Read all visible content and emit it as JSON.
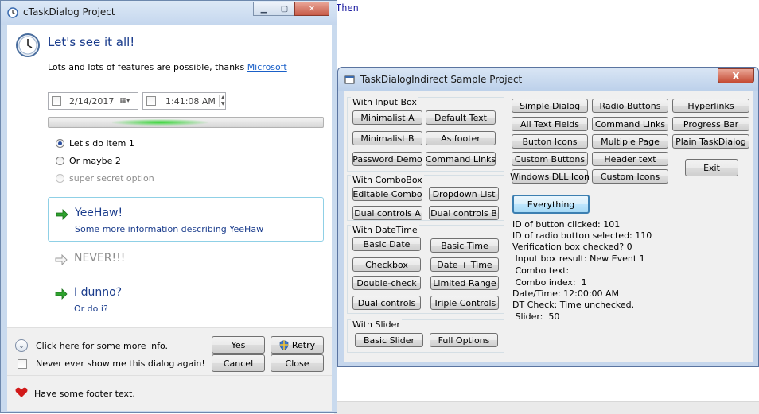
{
  "background": {
    "code_fragment": "Then"
  },
  "win1": {
    "title": "cTaskDialog Project",
    "main_instruction": "Let's see it all!",
    "content_prefix": "Lots and lots of features are possible, thanks ",
    "content_link": "Microsoft",
    "date_value": "2/14/2017",
    "time_value": "1:41:08 AM",
    "progress": 0.3,
    "radios": [
      {
        "label": "Let's do item 1",
        "selected": true
      },
      {
        "label": "Or maybe 2",
        "selected": false
      },
      {
        "label": "super secret option",
        "selected": false,
        "disabled": true
      }
    ],
    "command_links": [
      {
        "title": "YeeHaw!",
        "note": "Some more information describing YeeHaw"
      },
      {
        "title": "NEVER!!!",
        "note": ""
      },
      {
        "title": "I dunno?",
        "note": "Or do i?"
      }
    ],
    "expander_text": "Click here for some more info.",
    "verification_text": "Never ever show me this dialog again!",
    "buttons": {
      "yes": "Yes",
      "retry": "Retry",
      "cancel": "Cancel",
      "close": "Close"
    },
    "footer_text": "Have some footer text."
  },
  "win2": {
    "title": "TaskDialogIndirect Sample Project",
    "close_glyph": "X",
    "groups": {
      "input": {
        "title": "With Input Box",
        "buttons": [
          "Minimalist A",
          "Default Text",
          "Minimalist B",
          "As footer",
          "Password Demo",
          "Command Links"
        ]
      },
      "combo": {
        "title": "With ComboBox",
        "buttons": [
          "Editable Combo",
          "Dropdown List",
          "Dual controls A",
          "Dual controls B"
        ]
      },
      "datetime": {
        "title": "With DateTime",
        "buttons": [
          "Basic Date",
          "Basic Time",
          "Checkbox",
          "Date + Time",
          "Double-check",
          "Limited Range",
          "Dual controls",
          "Triple Controls"
        ]
      },
      "slider": {
        "title": "With Slider",
        "buttons": [
          "Basic Slider",
          "Full Options"
        ]
      }
    },
    "main_buttons": [
      "Simple Dialog",
      "Radio Buttons",
      "Hyperlinks",
      "All Text Fields",
      "Command Links",
      "Progress Bar",
      "Button Icons",
      "Multiple Page",
      "Plain TaskDialog",
      "Custom Buttons",
      "Header text",
      "Exit",
      "Windows DLL Icon",
      "Custom Icons",
      "Everything"
    ],
    "info_lines": [
      "ID of button clicked: 101",
      "ID of radio button selected: 110",
      "Verification box checked? 0",
      " Input box result: New Event 1",
      " Combo text:",
      " Combo index:  1",
      "Date/Time: 12:00:00 AM",
      "DT Check: Time unchecked.",
      " Slider:  50"
    ]
  }
}
